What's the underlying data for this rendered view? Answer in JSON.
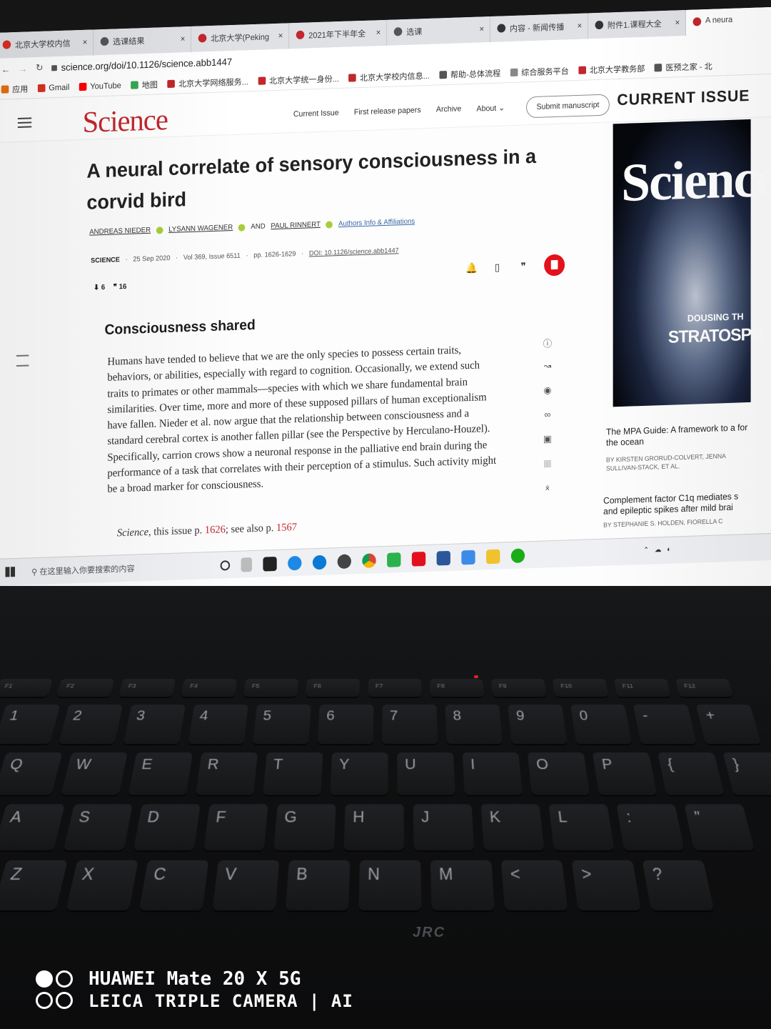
{
  "browser": {
    "tabs": [
      {
        "label": "北京大学校内信",
        "color": "#d93025"
      },
      {
        "label": "选课结果",
        "color": "#555555"
      },
      {
        "label": "北京大学(Peking",
        "color": "#c2272d"
      },
      {
        "label": "2021年下半年全",
        "color": "#c2272d"
      },
      {
        "label": "选课",
        "color": "#555555"
      },
      {
        "label": "内容 - 新闻传播",
        "color": "#333333"
      },
      {
        "label": "附件1.课程大全",
        "color": "#333333"
      },
      {
        "label": "A neura",
        "color": "#c2272d"
      }
    ],
    "url": "science.org/doi/10.1126/science.abb1447",
    "bookmarks": [
      {
        "label": "应用",
        "color": "#e8710a"
      },
      {
        "label": "Gmail",
        "color": "#d93025"
      },
      {
        "label": "YouTube",
        "color": "#ff0000"
      },
      {
        "label": "地图",
        "color": "#34a853"
      },
      {
        "label": "北京大学网络服务...",
        "color": "#c2272d"
      },
      {
        "label": "北京大学统一身份...",
        "color": "#c2272d"
      },
      {
        "label": "北京大学校内信息...",
        "color": "#c2272d"
      },
      {
        "label": "帮助-总体流程",
        "color": "#555555"
      },
      {
        "label": "综合服务平台",
        "color": "#888888"
      },
      {
        "label": "北京大学教务部",
        "color": "#c2272d"
      },
      {
        "label": "医预之家 - 北",
        "color": "#555555"
      }
    ]
  },
  "site": {
    "logo": "Science",
    "nav": [
      "Current Issue",
      "First release papers",
      "Archive",
      "About"
    ],
    "submit": "Submit manuscript"
  },
  "article": {
    "title": "A neural correlate of sensory consciousness in a corvid bird",
    "authors": [
      "ANDREAS NIEDER",
      "LYSANN WAGENER",
      "AND",
      "PAUL RINNERT"
    ],
    "authors_link": "Authors Info & Affiliations",
    "journal": "SCIENCE",
    "date": "25 Sep 2020",
    "volume": "Vol 369, Issue 6511",
    "pages": "pp. 1626-1629",
    "doi": "DOI: 10.1126/science.abb1447",
    "downloads": "6",
    "citations": "16",
    "section_heading": "Consciousness shared",
    "abstract": "Humans have tended to believe that we are the only species to possess certain traits, behaviors, or abilities, especially with regard to cognition. Occasionally, we extend such traits to primates or other mammals—species with which we share fundamental brain similarities. Over time, more and more of these supposed pillars of human exceptionalism have fallen. Nieder et al. now argue that the relationship between consciousness and a standard cerebral cortex is another fallen pillar (see the Perspective by Herculano-Houzel). Specifically, carrion crows show a neuronal response in the palliative end brain during the performance of a task that correlates with their perception of a stimulus. Such activity might be a broad marker for consciousness.",
    "cite_prefix": "Science",
    "cite_mid": ", this issue p. ",
    "cite_ref1": "1626",
    "cite_sep": "; see also p. ",
    "cite_ref2": "1567"
  },
  "sidebar": {
    "heading": "CURRENT ISSUE",
    "cover_title": "Science",
    "cover_line1": "DOUSING TH",
    "cover_line2": "STRATOSPH",
    "related": [
      {
        "title": "The MPA Guide: A framework to a for the ocean",
        "byline": "BY KIRSTEN GRORUD-COLVERT, JENNA SULLIVAN-STACK, ET AL."
      },
      {
        "title": "Complement factor C1q mediates s and epileptic spikes after mild brai",
        "byline": "BY STEPHANIE S. HOLDEN, FIORELLA C"
      }
    ]
  },
  "taskbar": {
    "search_placeholder": "在这里输入你要搜索的内容",
    "keyboard_brand": "JRC"
  },
  "watermark": {
    "line1": "HUAWEI Mate 20 X 5G",
    "line2": "LEICA TRIPLE CAMERA | AI"
  }
}
